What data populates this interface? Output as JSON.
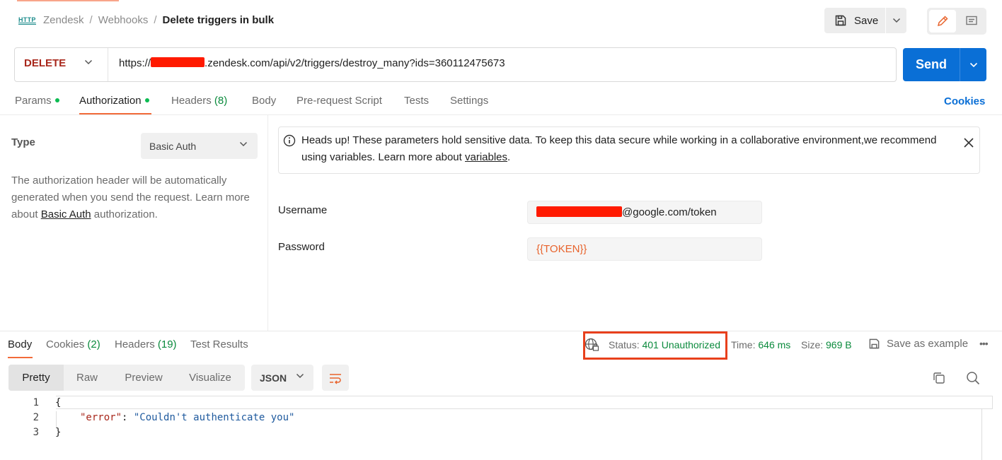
{
  "header": {
    "breadcrumb": [
      "Zendesk",
      "Webhooks",
      "Delete triggers in bulk"
    ],
    "protocol_badge": "HTTP",
    "save_label": "Save"
  },
  "request": {
    "method": "DELETE",
    "url_prefix": "https://",
    "url_suffix": ".zendesk.com/api/v2/triggers/destroy_many?ids=360112475673",
    "send_label": "Send"
  },
  "tabs": {
    "params": "Params",
    "authorization": "Authorization",
    "headers": "Headers",
    "headers_count": "(8)",
    "body": "Body",
    "pre_request": "Pre-request Script",
    "tests": "Tests",
    "settings": "Settings",
    "cookies": "Cookies"
  },
  "auth": {
    "type_label": "Type",
    "type_value": "Basic Auth",
    "desc_1": "The authorization header will be automatically generated when you send the request. Learn more about ",
    "desc_link": "Basic Auth",
    "desc_2": " authorization.",
    "notice_text": "Heads up! These parameters hold sensitive data. To keep this data secure while working in a collaborative environment,we recommend using variables. Learn more about ",
    "notice_link": "variables",
    "notice_end": ".",
    "username_label": "Username",
    "username_suffix": "@google.com/token",
    "password_label": "Password",
    "password_value": "{{TOKEN}}"
  },
  "response": {
    "tabs": {
      "body": "Body",
      "cookies": "Cookies",
      "cookies_count": "(2)",
      "headers": "Headers",
      "headers_count": "(19)",
      "test_results": "Test Results"
    },
    "status_label": "Status:",
    "status_value": "401 Unauthorized",
    "time_label": "Time:",
    "time_value": "646 ms",
    "size_label": "Size:",
    "size_value": "969 B",
    "save_example": "Save as example",
    "views": [
      "Pretty",
      "Raw",
      "Preview",
      "Visualize"
    ],
    "format": "JSON",
    "lines": [
      "1",
      "2",
      "3"
    ],
    "code": {
      "open": "{",
      "key": "\"error\"",
      "colon": ": ",
      "value": "\"Couldn't authenticate you\"",
      "close": "}"
    }
  },
  "colors": {
    "accent": "#f26b3a",
    "send": "#0a6fd6",
    "method": "#a8271b",
    "status_green": "#0a8a3c",
    "highlight_box": "#e8401c"
  }
}
